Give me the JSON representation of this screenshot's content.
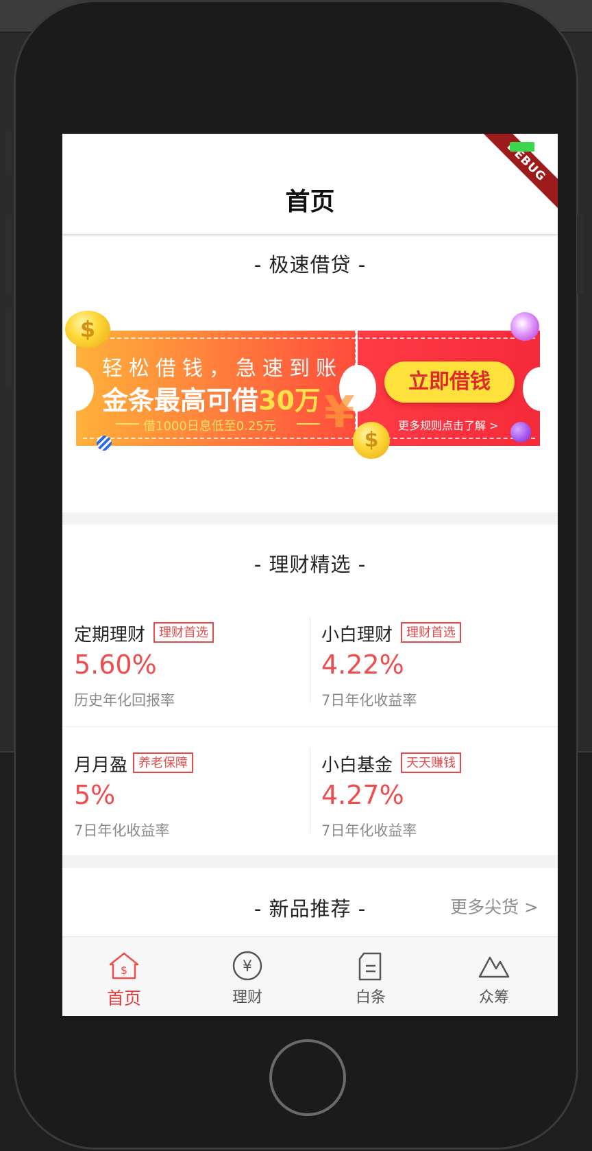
{
  "app": {
    "title": "首页",
    "debug_badge": "DEBUG"
  },
  "sections": {
    "loan": "- 极速借贷 -",
    "finance": "- 理财精选 -",
    "new_products": "- 新品推荐 -",
    "more_goods": "更多尖货 >"
  },
  "banner": {
    "line1": "轻松借钱，急速到账",
    "line2_prefix": "金条最高可借",
    "line2_highlight": "30万",
    "line3": "借1000日息低至0.25元",
    "button": "立即借钱",
    "more_rules": "更多规则点击了解 >"
  },
  "products": [
    {
      "name": "定期理财",
      "tag": "理财首选",
      "rate": "5.60%",
      "desc": "历史年化回报率"
    },
    {
      "name": "小白理财",
      "tag": "理财首选",
      "rate": "4.22%",
      "desc": "7日年化收益率"
    },
    {
      "name": "月月盈",
      "tag": "养老保障",
      "rate": "5%",
      "desc": "7日年化收益率"
    },
    {
      "name": "小白基金",
      "tag": "天天赚钱",
      "rate": "4.27%",
      "desc": "7日年化收益率"
    }
  ],
  "nav": [
    {
      "label": "首页",
      "icon": "home-dollar-icon",
      "active": true
    },
    {
      "label": "理财",
      "icon": "yen-circle-icon",
      "active": false
    },
    {
      "label": "白条",
      "icon": "document-icon",
      "active": false
    },
    {
      "label": "众筹",
      "icon": "mountain-icon",
      "active": false
    }
  ],
  "colors": {
    "accent": "#ef4d4d",
    "banner_orange": "#ff7a3c",
    "banner_red": "#f52a3a",
    "button_yellow": "#ffe13c"
  }
}
